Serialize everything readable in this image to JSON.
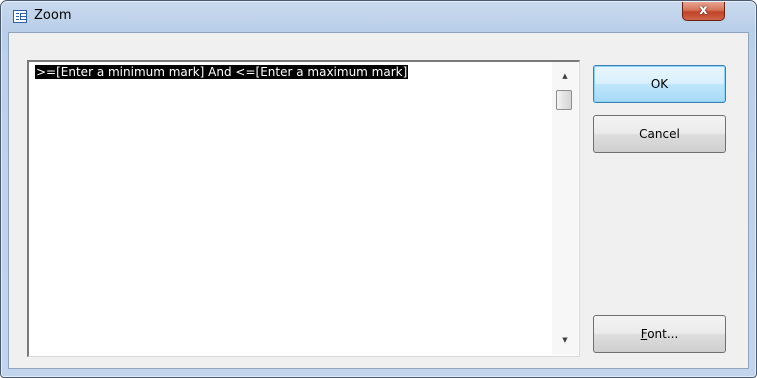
{
  "window": {
    "title": "Zoom",
    "close_glyph": "x"
  },
  "editor": {
    "content": ">=[Enter a minimum mark] And <=[Enter a maximum mark]"
  },
  "buttons": {
    "ok_label": "OK",
    "cancel_label": "Cancel",
    "font_label_mnemonic": "F",
    "font_label_rest": "ont..."
  },
  "scrollbar": {
    "up_glyph": "▲",
    "down_glyph": "▼"
  },
  "icons": {
    "app": "zoom-form-icon",
    "close": "close-icon",
    "scroll_up": "scroll-up-arrow-icon",
    "scroll_down": "scroll-down-arrow-icon"
  },
  "colors": {
    "titlebar": "#bcd0e9",
    "close_button": "#c0432a",
    "selection_bg": "#000000",
    "selection_fg": "#ffffff",
    "default_button_border": "#3c7fb1"
  }
}
